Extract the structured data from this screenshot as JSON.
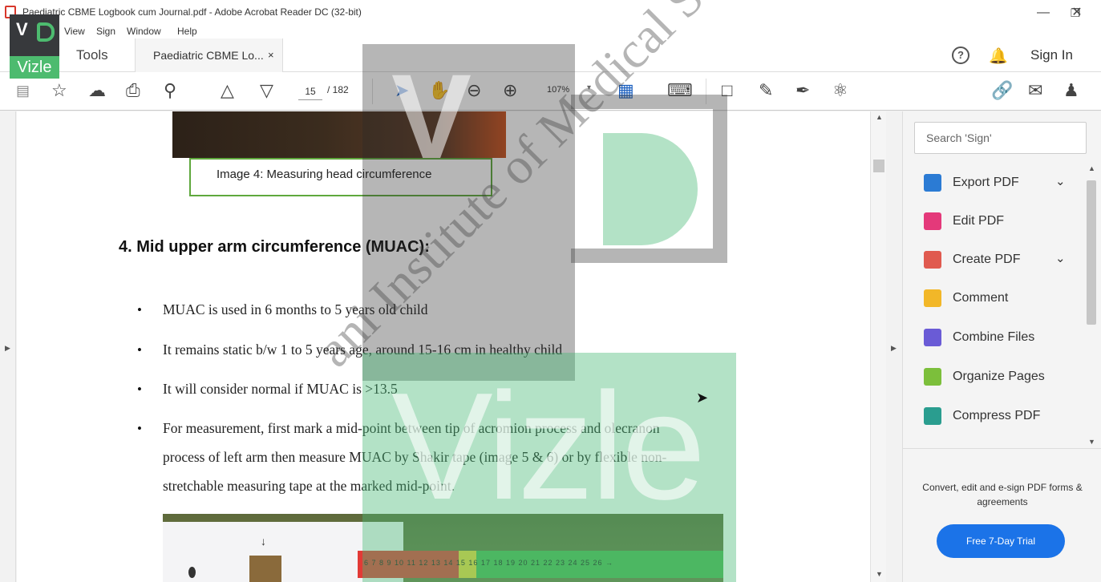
{
  "window": {
    "title": "Paediatric CBME Logbook cum Journal.pdf - Adobe Acrobat Reader DC (32-bit)",
    "minimize_glyph": "—",
    "maximize_glyph": "❐",
    "close_glyph": "✕"
  },
  "menu": [
    "View",
    "Sign",
    "Window",
    "Help"
  ],
  "tabs": {
    "tools": "Tools",
    "document": "Paediatric CBME Lo...",
    "close_glyph": "×"
  },
  "header_right": {
    "help": "?",
    "sign_in": "Sign In"
  },
  "toolbar": {
    "page_current": "15",
    "page_total": "/ 182",
    "zoom": "107%"
  },
  "document": {
    "caption": "Image 4: Measuring head circumference",
    "heading": "4.   Mid upper arm circumference (MUAC):",
    "bullet_glyph": "•",
    "bullets": [
      "MUAC is used in 6 months to 5 years old child",
      "It remains static b/w 1 to 5 years age, around 15-16 cm in healthy child",
      "It will consider normal if MUAC is >13.5",
      "For measurement, first mark a mid-point between tip of acromion process and olecranon",
      "process of left arm then measure MUAC by Shakir tape (image 5 & 6) or by flexible non-",
      "stretchable measuring tape at the marked mid-point."
    ],
    "ruler_numbers": "6  7  8  9  10  11  12  13  14  15  16  17  18  19  20  21  22  23  24  25  26  →"
  },
  "right_pane": {
    "search_placeholder": "Search 'Sign'",
    "tools": [
      {
        "label": "Export PDF",
        "icon": "export-pdf-icon",
        "color": "#2b7bd4",
        "chevron": true
      },
      {
        "label": "Edit PDF",
        "icon": "edit-pdf-icon",
        "color": "#e4397a",
        "chevron": false
      },
      {
        "label": "Create PDF",
        "icon": "create-pdf-icon",
        "color": "#e05a4f",
        "chevron": true
      },
      {
        "label": "Comment",
        "icon": "comment-icon",
        "color": "#f2b728",
        "chevron": false
      },
      {
        "label": "Combine Files",
        "icon": "combine-files-icon",
        "color": "#6a5bd6",
        "chevron": false
      },
      {
        "label": "Organize Pages",
        "icon": "organize-pages-icon",
        "color": "#7cbf3b",
        "chevron": false
      },
      {
        "label": "Compress PDF",
        "icon": "compress-pdf-icon",
        "color": "#2a9d8f",
        "chevron": false
      }
    ],
    "chevron_glyph": "⌄",
    "promo": "Convert, edit and e-sign PDF forms & agreements",
    "trial_button": "Free 7-Day Trial"
  },
  "watermark": {
    "logo_v": "V",
    "logo_word": "Vizle",
    "big_v": "V",
    "big_word": "Vizle",
    "diagonal": "ani Institute of Medical Science"
  }
}
